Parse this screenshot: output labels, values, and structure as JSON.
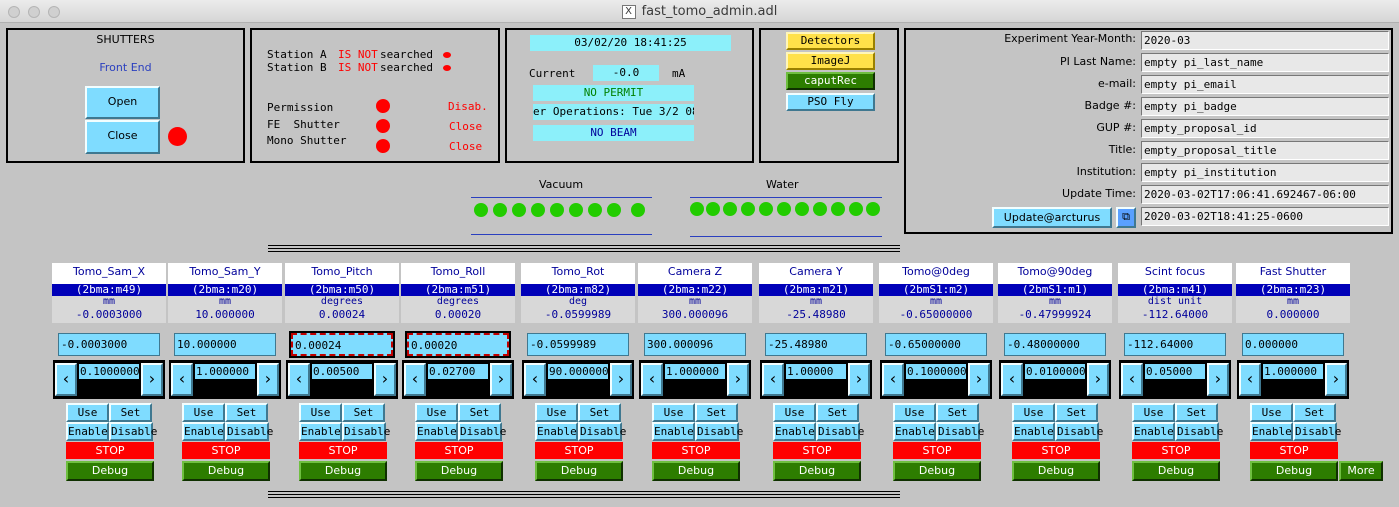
{
  "window": {
    "title": "fast_tomo_admin.adl"
  },
  "shutters": {
    "title": "SHUTTERS",
    "front_end": "Front End",
    "open": "Open",
    "close": "Close"
  },
  "station": {
    "a_label": "Station A",
    "a_status": "IS NOT",
    "a_searched": "searched",
    "b_label": "Station B",
    "b_status": "IS NOT",
    "b_searched": "searched",
    "permission_label": "Permission",
    "permission_value": "Disab.",
    "fe_shutter_label": "FE  Shutter",
    "fe_shutter_value": "Close",
    "mono_shutter_label": "Mono Shutter",
    "mono_shutter_value": "Close"
  },
  "beam": {
    "datetime": "03/02/20 18:41:25",
    "current_label": "Current",
    "current_value": "-0.0",
    "current_unit": "mA",
    "permit": "NO PERMIT",
    "operations": "er Operations: Tue 3/2 08:0",
    "beam_status": "NO BEAM"
  },
  "apps": {
    "detectors": "Detectors",
    "imagej": "ImageJ",
    "caputrec": "caputRec",
    "pso_fly": "PSO Fly"
  },
  "experiment": {
    "year_month_label": "Experiment Year-Month:",
    "year_month": "2020-03",
    "pi_last_name_label": "PI Last Name:",
    "pi_last_name": "empty pi_last_name",
    "email_label": "e-mail:",
    "email": "empty pi_email",
    "badge_label": "Badge #:",
    "badge": "empty pi_badge",
    "gup_label": "GUP #:",
    "gup": "empty_proposal_id",
    "title_label": "Title:",
    "title": "empty_proposal_title",
    "institution_label": "Institution:",
    "institution": "empty pi_institution",
    "update_time_label": "Update Time:",
    "update_time": "2020-03-02T17:06:41.692467-06:00",
    "update_button": "Update@arcturus",
    "update_result": "2020-03-02T18:41:25-0600"
  },
  "vacuum": {
    "label": "Vacuum"
  },
  "water": {
    "label": "Water"
  },
  "motors": [
    {
      "name": "Tomo_Sam_X",
      "pv": "(2bma:m49)",
      "unit": "mm",
      "readback": "-0.0003000",
      "setpoint": "-0.0003000",
      "tweak": "0.1000000",
      "use": "Use",
      "set": "Set",
      "enable": "Enable",
      "disable": "Disable",
      "stop": "STOP",
      "debug": "Debug"
    },
    {
      "name": "Tomo_Sam_Y",
      "pv": "(2bma:m20)",
      "unit": "mm",
      "readback": "10.000000",
      "setpoint": "10.000000",
      "tweak": "1.000000",
      "use": "Use",
      "set": "Set",
      "enable": "Enable",
      "disable": "Disable",
      "stop": "STOP",
      "debug": "Debug"
    },
    {
      "name": "Tomo_Pitch",
      "pv": "(2bma:m50)",
      "unit": "degrees",
      "readback": "0.00024",
      "setpoint": "0.00024",
      "tweak": "0.00500",
      "use": "Use",
      "set": "Set",
      "enable": "Enable",
      "disable": "Disable",
      "stop": "STOP",
      "debug": "Debug"
    },
    {
      "name": "Tomo_Roll",
      "pv": "(2bma:m51)",
      "unit": "degrees",
      "readback": "0.00020",
      "setpoint": "0.00020",
      "tweak": "0.02700",
      "use": "Use",
      "set": "Set",
      "enable": "Enable",
      "disable": "Disable",
      "stop": "STOP",
      "debug": "Debug"
    },
    {
      "name": "Tomo_Rot",
      "pv": "(2bma:m82)",
      "unit": "deg",
      "readback": "-0.0599989",
      "setpoint": "-0.0599989",
      "tweak": "90.0000000",
      "use": "Use",
      "set": "Set",
      "enable": "Enable",
      "disable": "Disable",
      "stop": "STOP",
      "debug": "Debug"
    },
    {
      "name": "Camera Z",
      "pv": "(2bma:m22)",
      "unit": "mm",
      "readback": "300.000096",
      "setpoint": "300.000096",
      "tweak": "1.000000",
      "use": "Use",
      "set": "Set",
      "enable": "Enable",
      "disable": "Disable",
      "stop": "STOP",
      "debug": "Debug"
    },
    {
      "name": "Camera Y",
      "pv": "(2bma:m21)",
      "unit": "mm",
      "readback": "-25.48980",
      "setpoint": "-25.48980",
      "tweak": "1.00000",
      "use": "Use",
      "set": "Set",
      "enable": "Enable",
      "disable": "Disable",
      "stop": "STOP",
      "debug": "Debug"
    },
    {
      "name": "Tomo@0deg",
      "pv": "(2bmS1:m2)",
      "unit": "mm",
      "readback": "-0.65000000",
      "setpoint": "-0.65000000",
      "tweak": "0.10000000",
      "use": "Use",
      "set": "Set",
      "enable": "Enable",
      "disable": "Disable",
      "stop": "STOP",
      "debug": "Debug"
    },
    {
      "name": "Tomo@90deg",
      "pv": "(2bmS1:m1)",
      "unit": "mm",
      "readback": "-0.47999924",
      "setpoint": "-0.48000000",
      "tweak": "0.01000000",
      "use": "Use",
      "set": "Set",
      "enable": "Enable",
      "disable": "Disable",
      "stop": "STOP",
      "debug": "Debug"
    },
    {
      "name": "Scint focus",
      "pv": "(2bma:m41)",
      "unit": "dist unit",
      "readback": "-112.64000",
      "setpoint": "-112.64000",
      "tweak": "0.05000",
      "use": "Use",
      "set": "Set",
      "enable": "Enable",
      "disable": "Disable",
      "stop": "STOP",
      "debug": "Debug"
    },
    {
      "name": "Fast Shutter",
      "pv": "(2bma:m23)",
      "unit": "mm",
      "readback": "0.000000",
      "setpoint": "0.000000",
      "tweak": "1.000000",
      "use": "Use",
      "set": "Set",
      "enable": "Enable",
      "disable": "Disable",
      "stop": "STOP",
      "debug": "Debug"
    }
  ],
  "more_button": "More",
  "colors": {
    "cyan": "#8cf0fa",
    "button_blue": "#7fdcff",
    "alarm_red": "#ff0000",
    "ok_green": "#22cc00",
    "debug_green": "#2d7d00",
    "pv_blue": "#0000b8"
  }
}
